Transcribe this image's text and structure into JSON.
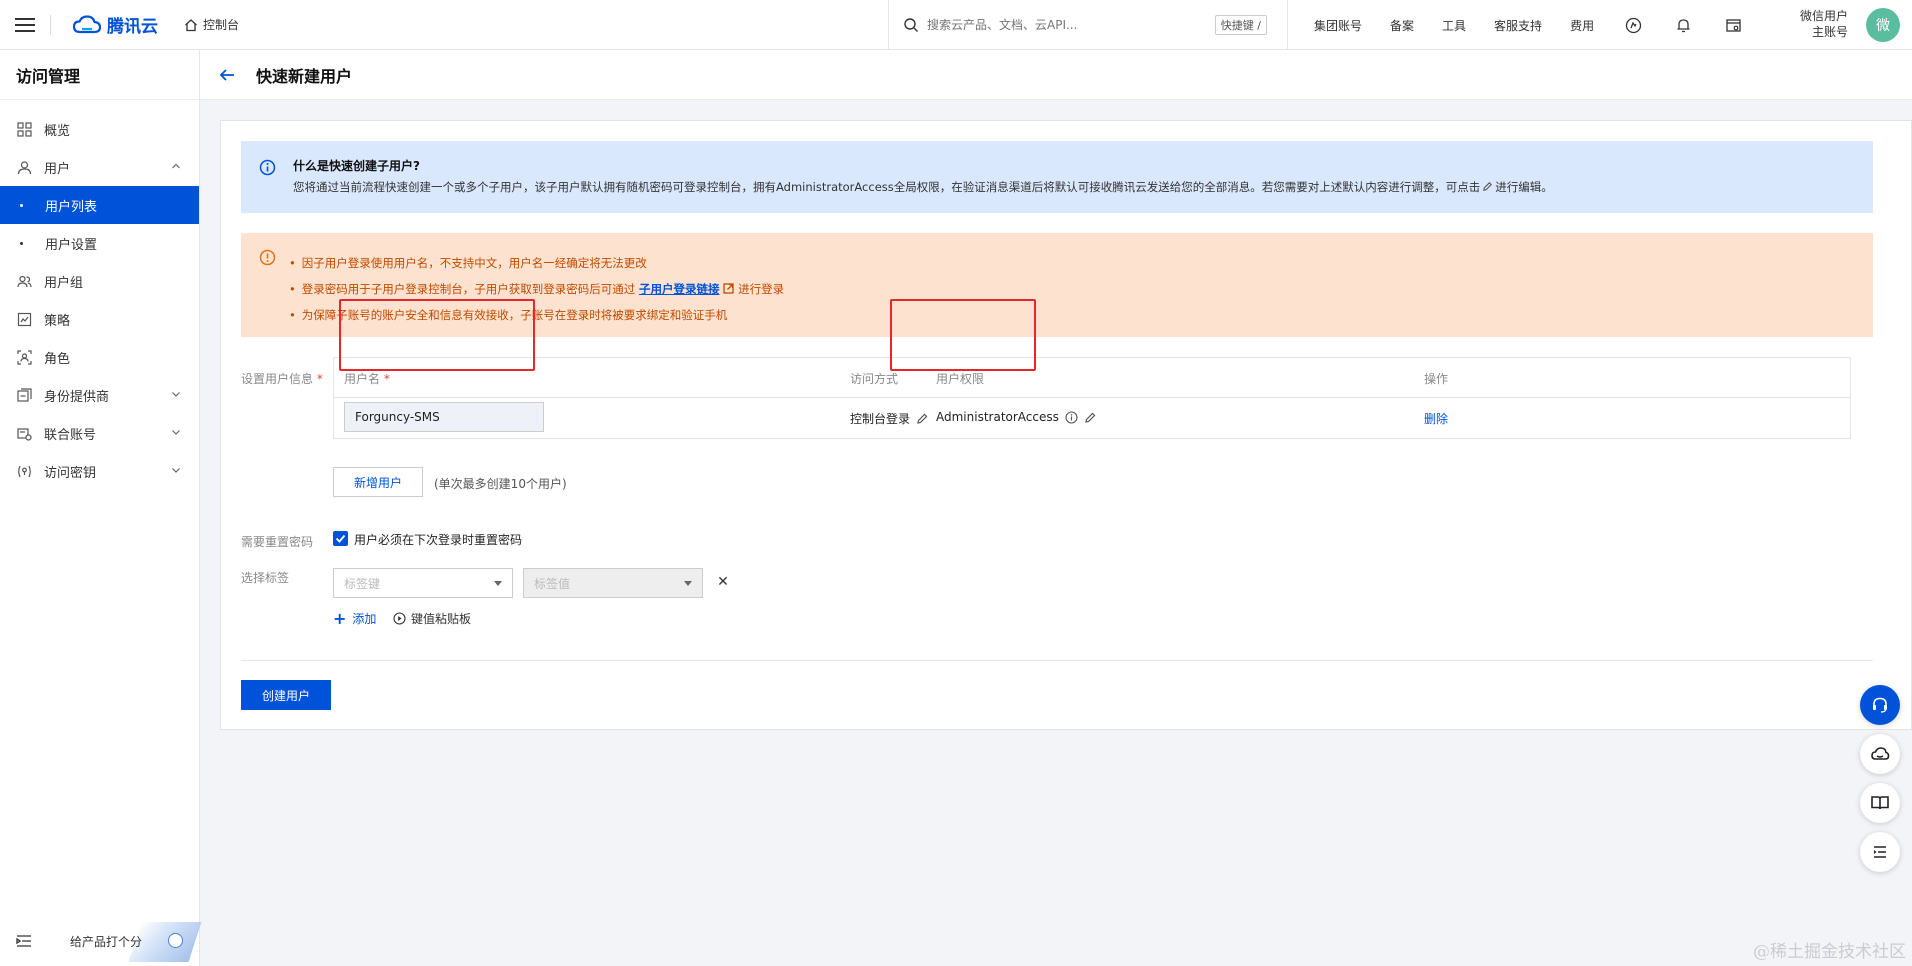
{
  "topbar": {
    "brand": "腾讯云",
    "console": "控制台",
    "search_placeholder": "搜索云产品、文档、云API...",
    "shortcut": "快捷键 /",
    "nav": [
      "集团账号",
      "备案",
      "工具",
      "客服支持",
      "费用"
    ],
    "user_line1": "微信用户",
    "user_line2": "主账号",
    "avatar": "微"
  },
  "sidebar": {
    "title": "访问管理",
    "items": [
      {
        "label": "概览",
        "icon": "grid-icon"
      },
      {
        "label": "用户",
        "icon": "user-icon"
      },
      {
        "label": "用户列表"
      },
      {
        "label": "用户设置"
      },
      {
        "label": "用户组",
        "icon": "user-group-icon"
      },
      {
        "label": "策略",
        "icon": "policy-icon"
      },
      {
        "label": "角色",
        "icon": "role-icon"
      },
      {
        "label": "身份提供商",
        "icon": "identity-provider-icon"
      },
      {
        "label": "联合账号",
        "icon": "federated-account-icon"
      },
      {
        "label": "访问密钥",
        "icon": "key-icon"
      }
    ],
    "feedback": "给产品打个分"
  },
  "page": {
    "title": "快速新建用户"
  },
  "info": {
    "title": "什么是快速创建子用户?",
    "text_before": "您将通过当前流程快速创建一个或多个子用户，该子用户默认拥有随机密码可登录控制台，拥有AdministratorAccess全局权限，在验证消息渠道后将默认可接收腾讯云发送给您的全部消息。若您需要对上述默认内容进行调整，可点击",
    "text_after": "进行编辑。"
  },
  "warning": {
    "line1": "因子用户登录使用用户名，不支持中文，用户名一经确定将无法更改",
    "line2_before": "登录密码用于子用户登录控制台，子用户获取到登录密码后可通过",
    "line2_link": "子用户登录链接",
    "line2_after": "进行登录",
    "line3": "为保障子账号的账户安全和信息有效接收，子账号在登录时将被要求绑定和验证手机"
  },
  "form": {
    "user_info_label": "设置用户信息",
    "required_mark": "*",
    "table": {
      "headers": {
        "username": "用户名",
        "access": "访问方式",
        "permission": "用户权限",
        "action": "操作"
      },
      "row": {
        "username": "Forguncy-SMS",
        "access": "控制台登录",
        "permission": "AdministratorAccess",
        "action": "删除"
      }
    },
    "add_user": "新增用户",
    "limit_note": "(单次最多创建10个用户)",
    "reset_label": "需要重置密码",
    "reset_checkbox": "用户必须在下次登录时重置密码",
    "tag_label": "选择标签",
    "tag_key_placeholder": "标签键",
    "tag_value_placeholder": "标签值",
    "add_tag": "添加",
    "paste": "键值粘贴板",
    "submit": "创建用户"
  },
  "watermark": "@稀土掘金技术社区"
}
